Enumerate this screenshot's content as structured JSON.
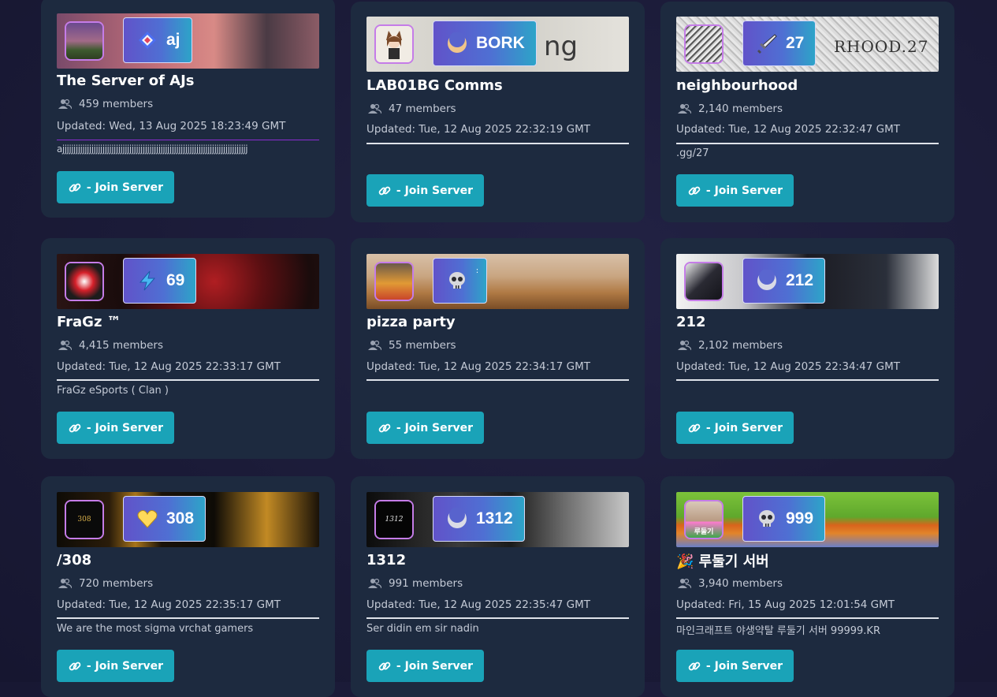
{
  "join_label": "- Join Server",
  "colors": {
    "accent": "#1aa3b8",
    "card": "#1d2a3f",
    "avatar_border": "#c57ce8",
    "tag_gradient": [
      "#6153c9",
      "#2da4c8"
    ]
  },
  "servers": [
    {
      "name": "The Server of AJs",
      "tag": "aj",
      "tag_icon": "diamond-sparkle-icon",
      "members": "459 members",
      "updated": "Updated: Wed, 13 Aug 2025 18:23:49 GMT",
      "description": "ajjjjjjjjjjjjjjjjjjjjjjjjjjjjjjjjjjjjjjjjjjjjjjjjjjjjjjjjjjjjjjjjjjjjjjjjjjjjjjjjjjj",
      "avatar_text": ""
    },
    {
      "name": "LAB01BG Comms",
      "tag": "BORK",
      "tag_icon": "crescent-icon",
      "members": "47 members",
      "updated": "Updated: Tue, 12 Aug 2025 22:32:19 GMT",
      "description": "",
      "avatar_text": "",
      "banner_text": "ng"
    },
    {
      "name": "neighbourhood",
      "tag": "27",
      "tag_icon": "sword-icon",
      "members": "2,140 members",
      "updated": "Updated: Tue, 12 Aug 2025 22:32:47 GMT",
      "description": ".gg/27",
      "avatar_text": "",
      "banner_text": "RHOOD.27"
    },
    {
      "name": "FraGz ™",
      "tag": "69",
      "tag_icon": "lightning-icon",
      "members": "4,415 members",
      "updated": "Updated: Tue, 12 Aug 2025 22:33:17 GMT",
      "description": "FraGz eSports ( Clan )",
      "avatar_text": ""
    },
    {
      "name": "pizza party",
      "tag": "ː",
      "tag_icon": "skull-icon",
      "members": "55 members",
      "updated": "Updated: Tue, 12 Aug 2025 22:34:17 GMT",
      "description": "",
      "avatar_text": ""
    },
    {
      "name": "212",
      "tag": "212",
      "tag_icon": "crescent-icon",
      "members": "2,102 members",
      "updated": "Updated: Tue, 12 Aug 2025 22:34:47 GMT",
      "description": "",
      "avatar_text": ""
    },
    {
      "name": "/308",
      "tag": "308",
      "tag_icon": "heart-icon",
      "members": "720 members",
      "updated": "Updated: Tue, 12 Aug 2025 22:35:17 GMT",
      "description": "We are the most sigma vrchat gamers",
      "avatar_text": "308"
    },
    {
      "name": "1312",
      "tag": "1312",
      "tag_icon": "crescent-icon",
      "members": "991 members",
      "updated": "Updated: Tue, 12 Aug 2025 22:35:47 GMT",
      "description": "Ser didin em sir nadin",
      "avatar_text": "1312"
    },
    {
      "name": "🎉 루둘기 서버",
      "tag": "999",
      "tag_icon": "skull-icon",
      "members": "3,940 members",
      "updated": "Updated: Fri, 15 Aug 2025 12:01:54 GMT",
      "description": "마인크래프트 야생약탈 루둘기 서버 99999.KR",
      "avatar_text": "루둘기"
    }
  ]
}
